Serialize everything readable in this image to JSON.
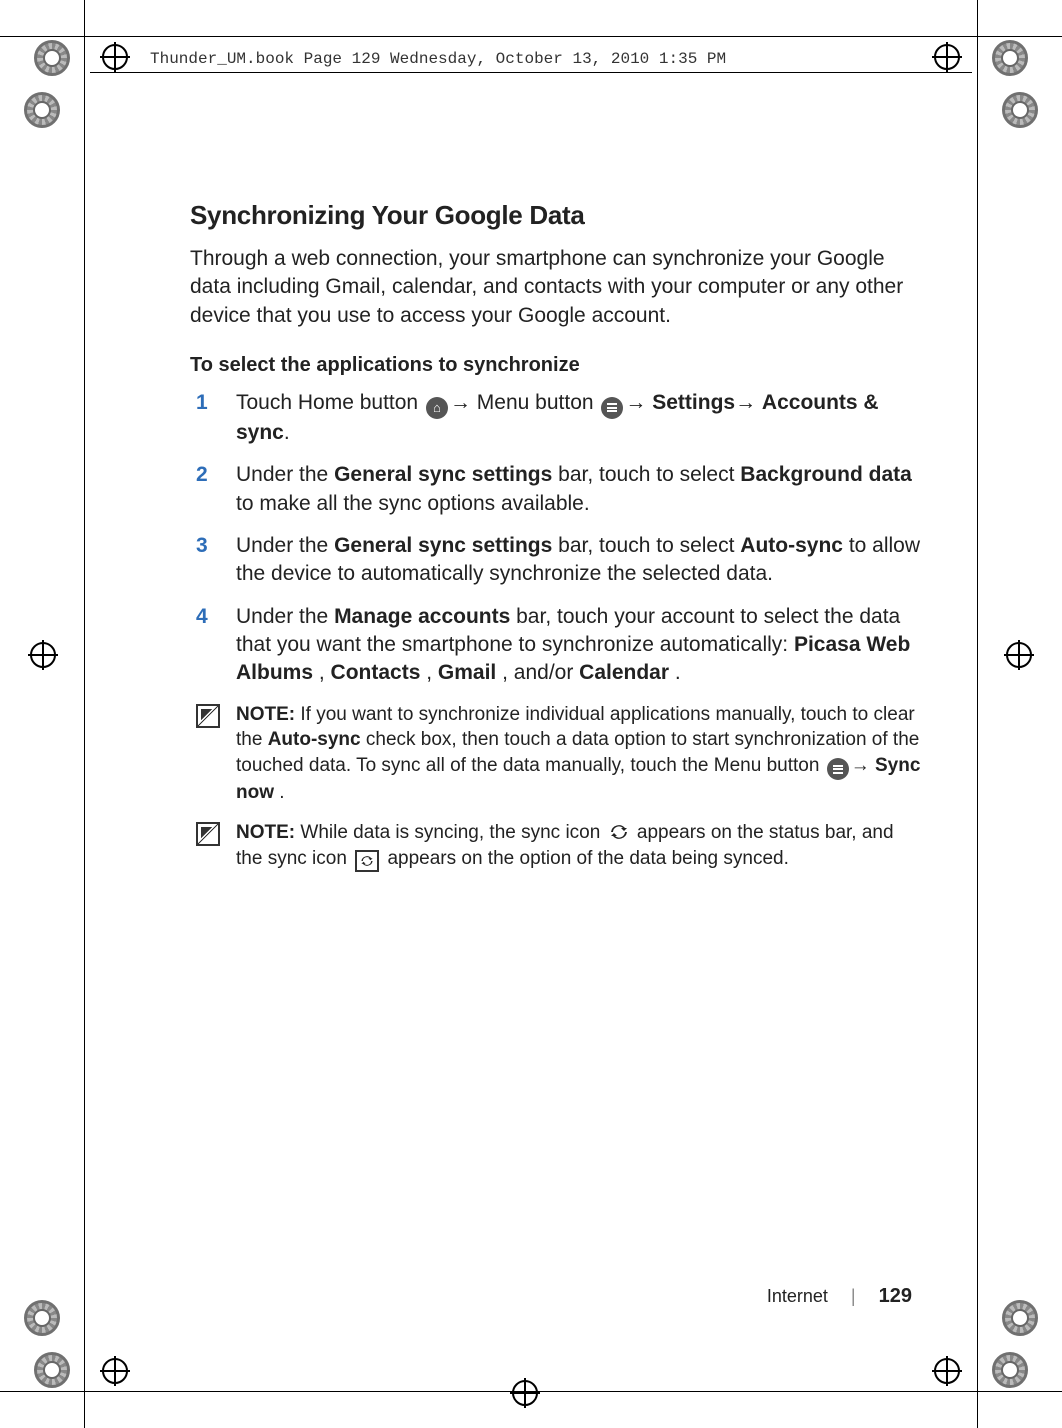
{
  "meta": {
    "filename_header": "Thunder_UM.book  Page 129  Wednesday, October 13, 2010  1:35 PM"
  },
  "heading": "Synchronizing Your Google Data",
  "intro": "Through a web connection, your smartphone can synchronize your Google data including Gmail, calendar, and contacts with your computer or any other device that you use to access your Google account.",
  "subheading": "To select the applications to synchronize",
  "steps": {
    "s1_pre": "Touch Home button ",
    "s1_mid": " Menu button ",
    "s1_settings": "Settings",
    "s1_accounts": "Accounts & sync",
    "s2_pre": "Under the ",
    "s2_b1": "General sync settings",
    "s2_mid": " bar, touch to select ",
    "s2_b2": "Background data",
    "s2_post": " to make all the sync options available.",
    "s3_pre": "Under the ",
    "s3_b1": "General sync settings",
    "s3_mid": " bar, touch to select ",
    "s3_b2": "Auto-sync",
    "s3_post": " to allow the device to automatically synchronize the selected data.",
    "s4_pre": "Under the ",
    "s4_b1": "Manage accounts",
    "s4_mid": " bar, touch your account to select the data that you want the smartphone to synchronize automatically: ",
    "s4_b2": "Picasa Web Albums",
    "s4_sep1": ", ",
    "s4_b3": "Contacts",
    "s4_sep2": ", ",
    "s4_b4": "Gmail",
    "s4_sep3": ", and/or ",
    "s4_b5": "Calendar",
    "s4_end": "."
  },
  "notes": {
    "label": "NOTE:",
    "n1_a": " If you want to synchronize individual applications manually, touch to clear the ",
    "n1_b": "Auto-sync",
    "n1_c": " check box, then touch a data option to start synchronization of the touched data. To sync all of the data manually, touch the Menu button ",
    "n1_sync": "Sync now",
    "n1_end": ".",
    "n2_a": " While data is syncing, the sync icon ",
    "n2_b": " appears on the status bar, and the sync icon ",
    "n2_c": " appears on the option of the data being synced."
  },
  "footer": {
    "section": "Internet",
    "page": "129"
  }
}
